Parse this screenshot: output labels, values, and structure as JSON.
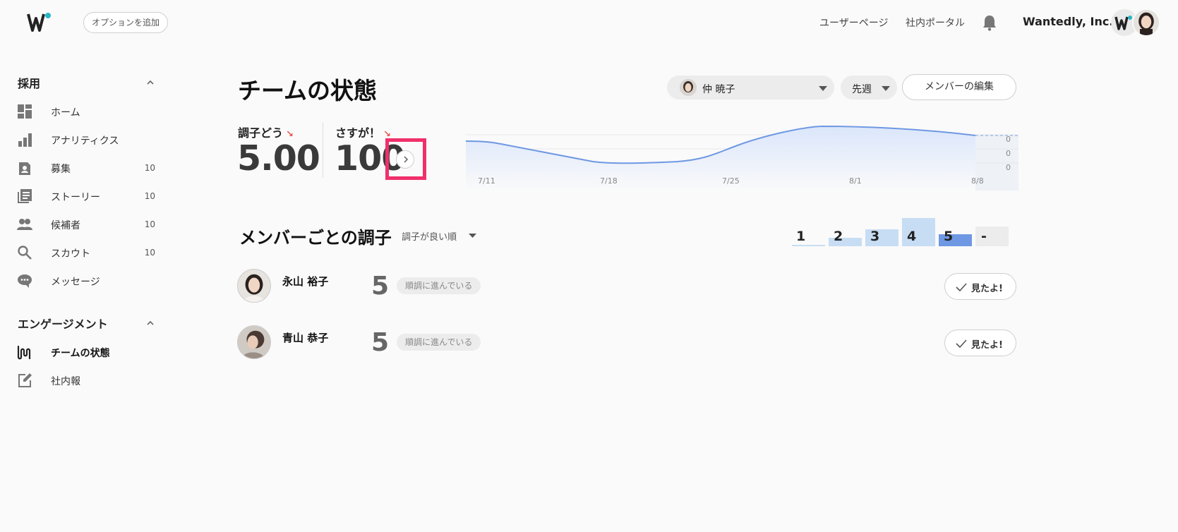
{
  "header": {
    "add_option_label": "オプションを追加",
    "links": [
      "ユーザーページ",
      "社内ポータル"
    ],
    "company": "Wantedly, Inc."
  },
  "sidebar": {
    "recruit_section": "採用",
    "recruit_items": [
      {
        "label": "ホーム",
        "count": "",
        "icon": "dashboard-icon"
      },
      {
        "label": "アナリティクス",
        "count": "",
        "icon": "bar-chart-icon"
      },
      {
        "label": "募集",
        "count": "10",
        "icon": "badge-icon"
      },
      {
        "label": "ストーリー",
        "count": "10",
        "icon": "stories-icon"
      },
      {
        "label": "候補者",
        "count": "10",
        "icon": "people-icon"
      },
      {
        "label": "スカウト",
        "count": "10",
        "icon": "search-icon"
      },
      {
        "label": "メッセージ",
        "count": "",
        "icon": "chat-icon"
      }
    ],
    "engagement_section": "エンゲージメント",
    "engagement_items": [
      {
        "label": "チームの状態",
        "icon": "pulse-icon",
        "active": true
      },
      {
        "label": "社内報",
        "icon": "edit-icon",
        "active": false
      }
    ]
  },
  "main": {
    "title": "チームの状態",
    "person_select": "仲 暁子",
    "period_select": "先週",
    "edit_members": "メンバーの編集",
    "metrics": [
      {
        "label": "調子どう",
        "value": "5.00"
      },
      {
        "label": "さすが！",
        "value": "100"
      }
    ],
    "chart_x_ticks": [
      "7/11",
      "7/18",
      "7/25",
      "8/1",
      "8/8"
    ],
    "chart_y_ticks": [
      "0",
      "0",
      "0"
    ],
    "members_title": "メンバーごとの調子",
    "sort_label": "調子が良い順",
    "distribution": {
      "labels": [
        "1",
        "2",
        "3",
        "4",
        "5",
        "-"
      ],
      "levels": [
        0.05,
        0.3,
        0.6,
        1.0,
        0.42,
        0.7
      ],
      "colors": [
        "#c7ddf4",
        "#c7ddf4",
        "#c7ddf4",
        "#c7ddf4",
        "#6e98e3",
        "#ececec"
      ]
    },
    "members": [
      {
        "name": "永山 裕子",
        "score": "5",
        "status": "順調に進んでいる",
        "action": "見たよ!"
      },
      {
        "name": "青山 恭子",
        "score": "5",
        "status": "順調に進んでいる",
        "action": "見たよ!"
      }
    ]
  },
  "colors": {
    "accent": "#29b6c6",
    "highlight": "#f0306b",
    "chart_line": "#6e98e3",
    "trend_down": "#e8554e"
  }
}
